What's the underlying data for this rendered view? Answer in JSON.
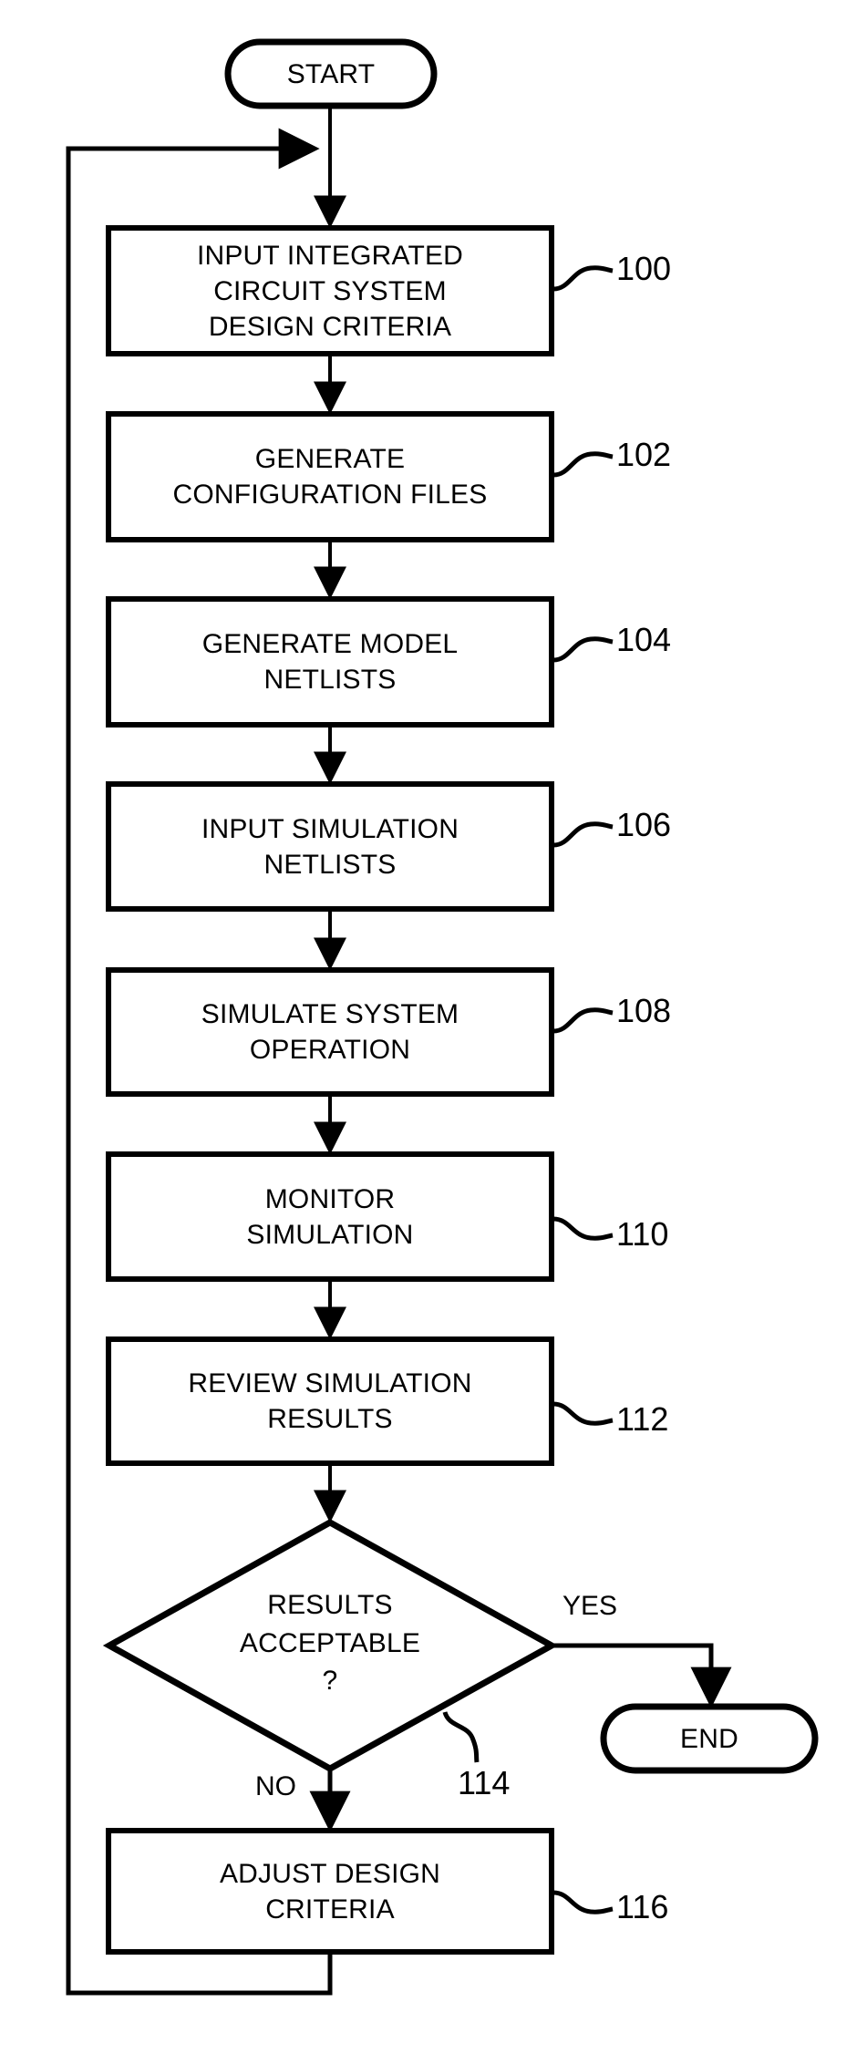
{
  "diagram": {
    "type": "flowchart",
    "title": "Integrated circuit system simulation design flow",
    "colors": {
      "stroke": "#000000",
      "fill": "#ffffff",
      "text": "#000000"
    },
    "nodes": [
      {
        "id": "start",
        "shape": "terminator",
        "label": "START",
        "lines": [
          "START"
        ],
        "ref": null
      },
      {
        "id": "n100",
        "shape": "process",
        "label": "INPUT INTEGRATED CIRCUIT SYSTEM DESIGN CRITERIA",
        "lines": [
          "INPUT INTEGRATED",
          "CIRCUIT SYSTEM",
          "DESIGN CRITERIA"
        ],
        "ref": "100"
      },
      {
        "id": "n102",
        "shape": "process",
        "label": "GENERATE CONFIGURATION FILES",
        "lines": [
          "GENERATE",
          "CONFIGURATION FILES"
        ],
        "ref": "102"
      },
      {
        "id": "n104",
        "shape": "process",
        "label": "GENERATE MODEL NETLISTS",
        "lines": [
          "GENERATE MODEL",
          "NETLISTS"
        ],
        "ref": "104"
      },
      {
        "id": "n106",
        "shape": "process",
        "label": "INPUT SIMULATION NETLISTS",
        "lines": [
          "INPUT SIMULATION",
          "NETLISTS"
        ],
        "ref": "106"
      },
      {
        "id": "n108",
        "shape": "process",
        "label": "SIMULATE SYSTEM OPERATION",
        "lines": [
          "SIMULATE SYSTEM",
          "OPERATION"
        ],
        "ref": "108"
      },
      {
        "id": "n110",
        "shape": "process",
        "label": "MONITOR SIMULATION",
        "lines": [
          "MONITOR",
          "SIMULATION"
        ],
        "ref": "110"
      },
      {
        "id": "n112",
        "shape": "process",
        "label": "REVIEW SIMULATION RESULTS",
        "lines": [
          "REVIEW SIMULATION",
          "RESULTS"
        ],
        "ref": "112"
      },
      {
        "id": "n114",
        "shape": "decision",
        "label": "RESULTS ACCEPTABLE ?",
        "lines": [
          "RESULTS",
          "ACCEPTABLE",
          "?"
        ],
        "ref": "114"
      },
      {
        "id": "n116",
        "shape": "process",
        "label": "ADJUST DESIGN CRITERIA",
        "lines": [
          "ADJUST DESIGN",
          "CRITERIA"
        ],
        "ref": "116"
      },
      {
        "id": "end",
        "shape": "terminator",
        "label": "END",
        "lines": [
          "END"
        ],
        "ref": null
      }
    ],
    "edge_labels": {
      "yes": "YES",
      "no": "NO"
    },
    "edges": [
      {
        "from": "start",
        "to": "n100",
        "label": ""
      },
      {
        "from": "n100",
        "to": "n102",
        "label": ""
      },
      {
        "from": "n102",
        "to": "n104",
        "label": ""
      },
      {
        "from": "n104",
        "to": "n106",
        "label": ""
      },
      {
        "from": "n106",
        "to": "n108",
        "label": ""
      },
      {
        "from": "n108",
        "to": "n110",
        "label": ""
      },
      {
        "from": "n110",
        "to": "n112",
        "label": ""
      },
      {
        "from": "n112",
        "to": "n114",
        "label": ""
      },
      {
        "from": "n114",
        "to": "end",
        "label": "YES"
      },
      {
        "from": "n114",
        "to": "n116",
        "label": "NO"
      },
      {
        "from": "n116",
        "to": "n100",
        "label": ""
      }
    ]
  }
}
